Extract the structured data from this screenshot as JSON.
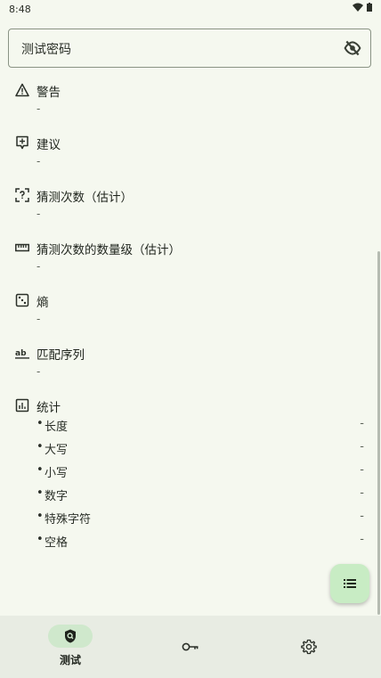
{
  "status_bar": {
    "time": "8:48"
  },
  "password_field": {
    "value": "测试密码"
  },
  "sections": {
    "warning": {
      "title": "警告",
      "value": "-"
    },
    "suggestions": {
      "title": "建议",
      "value": "-"
    },
    "guesses": {
      "title": "猜测次数（估计）",
      "value": "-"
    },
    "guesses_log": {
      "title": "猜测次数的数量级（估计）",
      "value": "-"
    },
    "entropy": {
      "title": "熵",
      "value": "-"
    },
    "match_sequence": {
      "title": "匹配序列",
      "value": "-"
    },
    "statistics": {
      "title": "统计",
      "rows": [
        {
          "label": "长度",
          "value": "-"
        },
        {
          "label": "大写",
          "value": "-"
        },
        {
          "label": "小写",
          "value": "-"
        },
        {
          "label": "数字",
          "value": "-"
        },
        {
          "label": "特殊字符",
          "value": "-"
        },
        {
          "label": "空格",
          "value": "-"
        }
      ]
    }
  },
  "bullet": "•",
  "fab": {
    "icon": "list-icon"
  },
  "bottom_nav": {
    "items": [
      {
        "label": "测试",
        "icon": "shield-search-icon",
        "active": true
      },
      {
        "icon": "key-icon"
      },
      {
        "icon": "gear-icon"
      }
    ]
  },
  "colors": {
    "background": "#f5f8ef",
    "accent": "#c8ecc4",
    "nav_bg": "#e8ece3"
  }
}
